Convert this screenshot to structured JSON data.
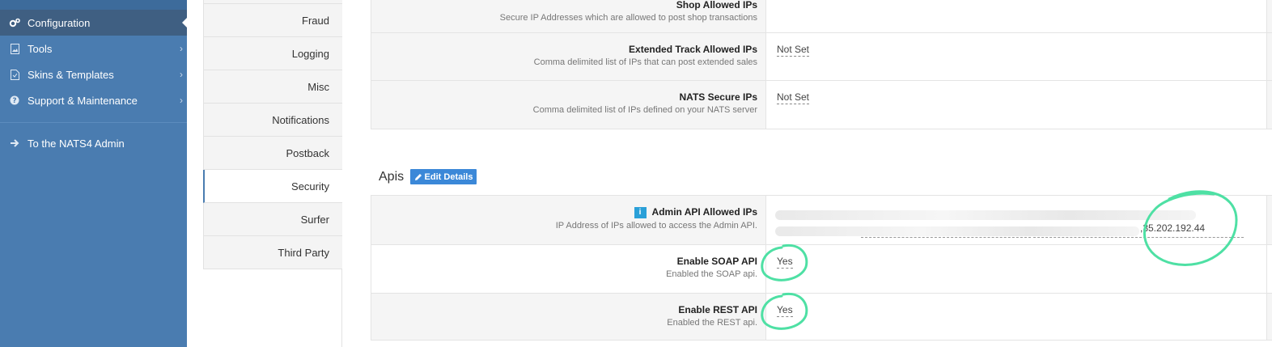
{
  "sidebar": {
    "items": [
      {
        "label": "Configuration",
        "icon": "gears-icon"
      },
      {
        "label": "Tools",
        "icon": "image-icon"
      },
      {
        "label": "Skins & Templates",
        "icon": "file-icon"
      },
      {
        "label": "Support & Maintenance",
        "icon": "question-circle-icon"
      },
      {
        "label": "To the NATS4 Admin",
        "icon": "arrow-right-icon"
      }
    ],
    "active": "Configuration"
  },
  "tabs": [
    "Fraud",
    "Logging",
    "Misc",
    "Notifications",
    "Postback",
    "Security",
    "Surfer",
    "Third Party"
  ],
  "active_tab": "Security",
  "security_rows": [
    {
      "title": "Shop Allowed IPs",
      "desc": "Secure IP Addresses which are allowed to post shop transactions",
      "value": ""
    },
    {
      "title": "Extended Track Allowed IPs",
      "desc": "Comma delimited list of IPs that can post extended sales",
      "value": "Not Set"
    },
    {
      "title": "NATS Secure IPs",
      "desc": "Comma delimited list of IPs defined on your NATS server",
      "value": "Not Set"
    }
  ],
  "apis": {
    "section_title": "Apis",
    "edit_label": "Edit Details",
    "rows": [
      {
        "title": "Admin API Allowed IPs",
        "desc": "IP Address of IPs allowed to access the Admin API.",
        "value": ",35.202.192.44",
        "info_badge": "i"
      },
      {
        "title": "Enable SOAP API",
        "desc": "Enabled the SOAP api.",
        "value": "Yes"
      },
      {
        "title": "Enable REST API",
        "desc": "Enabled the REST api.",
        "value": "Yes"
      }
    ]
  },
  "colors": {
    "sidebar": "#4a7cb0",
    "sidebar_active": "#3f5f82",
    "edit_button": "#3b88d8",
    "annotation": "#4ee0a4"
  }
}
